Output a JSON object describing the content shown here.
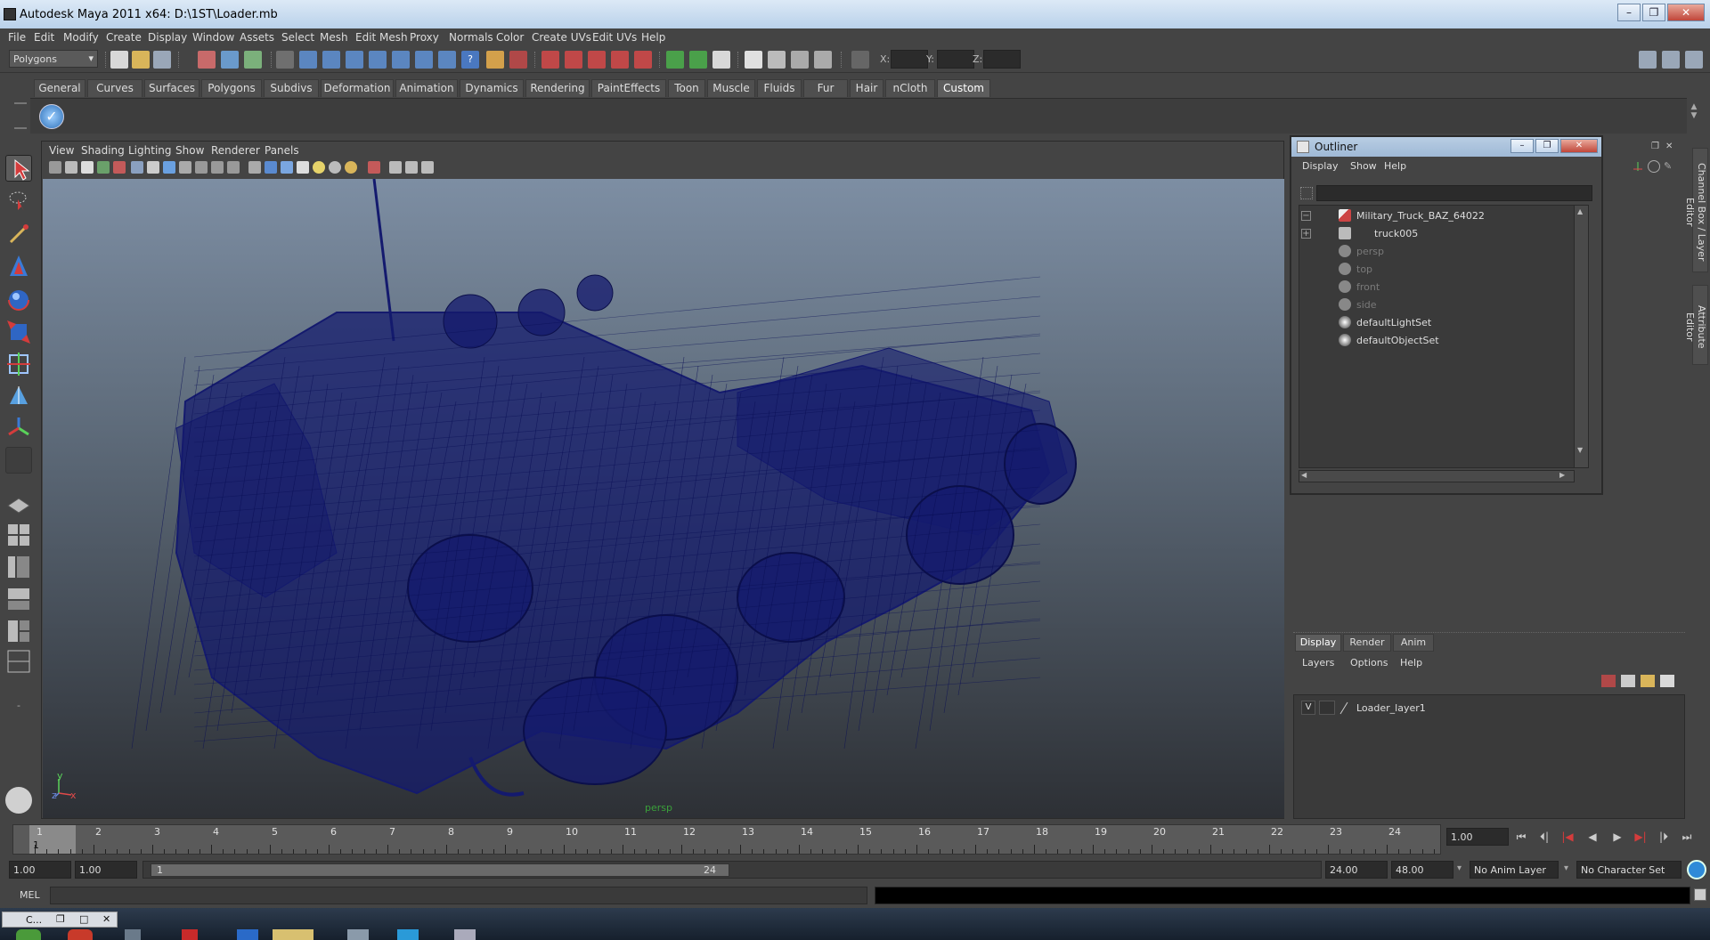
{
  "window": {
    "title": "Autodesk Maya 2011 x64: D:\\1ST\\Loader.mb"
  },
  "menubar": [
    "File",
    "Edit",
    "Modify",
    "Create",
    "Display",
    "Window",
    "Assets",
    "Select",
    "Mesh",
    "Edit Mesh",
    "Proxy",
    "Normals",
    "Color",
    "Create UVs",
    "Edit UVs",
    "Help"
  ],
  "status_line": {
    "mode": "Polygons",
    "x_label": "X:",
    "y_label": "Y:",
    "z_label": "Z:"
  },
  "shelf": {
    "tabs": [
      "General",
      "Curves",
      "Surfaces",
      "Polygons",
      "Subdivs",
      "Deformation",
      "Animation",
      "Dynamics",
      "Rendering",
      "PaintEffects",
      "Toon",
      "Muscle",
      "Fluids",
      "Fur",
      "Hair",
      "nCloth",
      "Custom"
    ],
    "active": "Custom"
  },
  "viewport": {
    "menu": [
      "View",
      "Shading",
      "Lighting",
      "Show",
      "Renderer",
      "Panels"
    ],
    "camera_label": "persp",
    "axis_y": "y",
    "axis_z": "z",
    "axis_x": "x"
  },
  "outliner": {
    "title": "Outliner",
    "menu": [
      "Display",
      "Show",
      "Help"
    ],
    "items": [
      {
        "label": "Military_Truck_BAZ_64022",
        "dim": false,
        "expander": "−"
      },
      {
        "label": "truck005",
        "dim": false,
        "expander": "+"
      },
      {
        "label": "persp",
        "dim": true,
        "expander": ""
      },
      {
        "label": "top",
        "dim": true,
        "expander": ""
      },
      {
        "label": "front",
        "dim": true,
        "expander": ""
      },
      {
        "label": "side",
        "dim": true,
        "expander": ""
      },
      {
        "label": "defaultLightSet",
        "dim": false,
        "expander": ""
      },
      {
        "label": "defaultObjectSet",
        "dim": false,
        "expander": ""
      }
    ]
  },
  "side_tabs": {
    "channel_box": "Channel Box / Layer Editor",
    "attribute_editor": "Attribute Editor"
  },
  "layer_editor": {
    "tabs": [
      "Display",
      "Render",
      "Anim"
    ],
    "active_tab": "Display",
    "menu": [
      "Layers",
      "Options",
      "Help"
    ],
    "layers": [
      {
        "visible": "V",
        "name": "Loader_layer1"
      }
    ]
  },
  "time_slider": {
    "ticks": [
      "1",
      "2",
      "3",
      "4",
      "5",
      "6",
      "7",
      "8",
      "9",
      "10",
      "11",
      "12",
      "13",
      "14",
      "15",
      "16",
      "17",
      "18",
      "19",
      "20",
      "21",
      "22",
      "23",
      "24"
    ],
    "current_frame": "1",
    "current_time_field": "1.00"
  },
  "range_slider": {
    "start_time": "1.00",
    "playback_start": "1.00",
    "handle_start": "1",
    "handle_end": "24",
    "playback_end": "24.00",
    "end_time": "48.00",
    "anim_layer": "No Anim Layer",
    "character_set": "No Character Set"
  },
  "command_line": {
    "label": "MEL"
  },
  "taskbar": {
    "maya_thumb": "C..."
  },
  "colors": {
    "wireframe": "#141a6e",
    "viewport_top": "#7d8ea3",
    "viewport_bottom": "#2d3035",
    "selection_accent": "#5d5d5d"
  }
}
